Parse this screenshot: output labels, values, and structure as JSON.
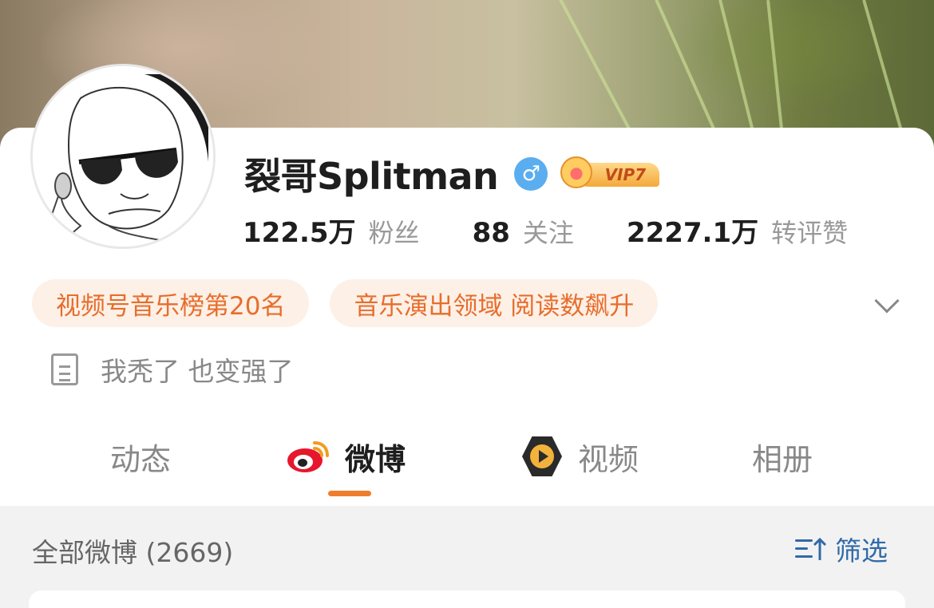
{
  "profile": {
    "name": "裂哥Splitman",
    "gender_icon": "male-icon",
    "gender_symbol": "♂",
    "vip_label": "VIP7",
    "bio": "我秃了 也变强了"
  },
  "stats": [
    {
      "value": "122.5万",
      "label": "粉丝"
    },
    {
      "value": "88",
      "label": "关注"
    },
    {
      "value": "2227.1万",
      "label": "转评赞"
    }
  ],
  "tags": [
    "视频号音乐榜第20名",
    "音乐演出领域 阅读数飙升"
  ],
  "tabs": [
    {
      "label": "动态",
      "active": false
    },
    {
      "label": "微博",
      "active": true,
      "icon": "weibo-logo-icon"
    },
    {
      "label": "视频",
      "active": false,
      "icon": "video-icon"
    },
    {
      "label": "相册",
      "active": false
    }
  ],
  "feed": {
    "all_posts_label": "全部微博 (2669)",
    "filter_label": "筛选"
  },
  "colors": {
    "accent": "#f07c2d",
    "tag_bg": "#fdf0e6",
    "tag_text": "#e76d2c",
    "link_blue": "#2f6aa9",
    "gender_blue": "#5aaef0"
  }
}
